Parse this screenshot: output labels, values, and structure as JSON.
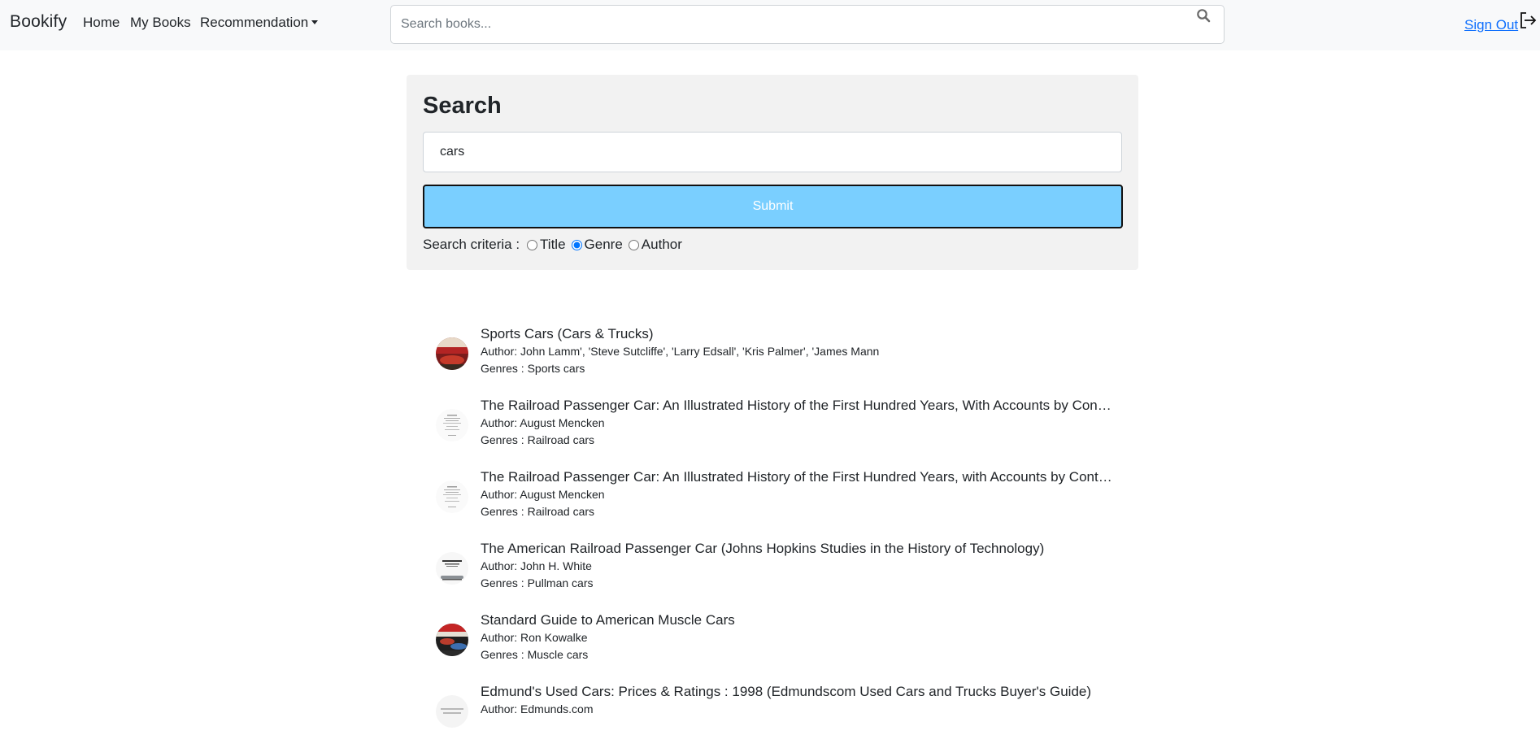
{
  "navbar": {
    "brand": "Bookify",
    "links": [
      "Home",
      "My Books",
      "Recommendation"
    ],
    "search_placeholder": "Search books...",
    "signout": "Sign Out"
  },
  "search_card": {
    "title": "Search",
    "query": "cars",
    "submit_label": "Submit",
    "criteria_label": "Search criteria :",
    "criteria_options": [
      "Title",
      "Genre",
      "Author"
    ],
    "selected_criteria": "Genre"
  },
  "results": [
    {
      "title": "Sports Cars (Cars & Trucks)",
      "author": "Author: John Lamm', 'Steve Sutcliffe', 'Larry Edsall', 'Kris Palmer', 'James Mann",
      "genres": "Genres : Sports cars"
    },
    {
      "title": "The Railroad Passenger Car: An Illustrated History of the First Hundred Years, With Accounts by Contempor...",
      "author": "Author: August Mencken",
      "genres": "Genres : Railroad cars"
    },
    {
      "title": "The Railroad Passenger Car: An Illustrated History of the First Hundred Years, with Accounts by Contempor...",
      "author": "Author: August Mencken",
      "genres": "Genres : Railroad cars"
    },
    {
      "title": "The American Railroad Passenger Car (Johns Hopkins Studies in the History of Technology)",
      "author": "Author: John H. White",
      "genres": "Genres : Pullman cars"
    },
    {
      "title": "Standard Guide to American Muscle Cars",
      "author": "Author: Ron Kowalke",
      "genres": "Genres : Muscle cars"
    },
    {
      "title": "Edmund's Used Cars: Prices & Ratings : 1998 (Edmundscom Used Cars and Trucks Buyer's Guide)",
      "author": "Author: Edmunds.com",
      "genres": ""
    }
  ],
  "colors": {
    "navbar_bg": "#f8f9fa",
    "link": "#0d6efd",
    "submit_bg": "#7acfff",
    "card_bg": "#f2f2f2"
  }
}
